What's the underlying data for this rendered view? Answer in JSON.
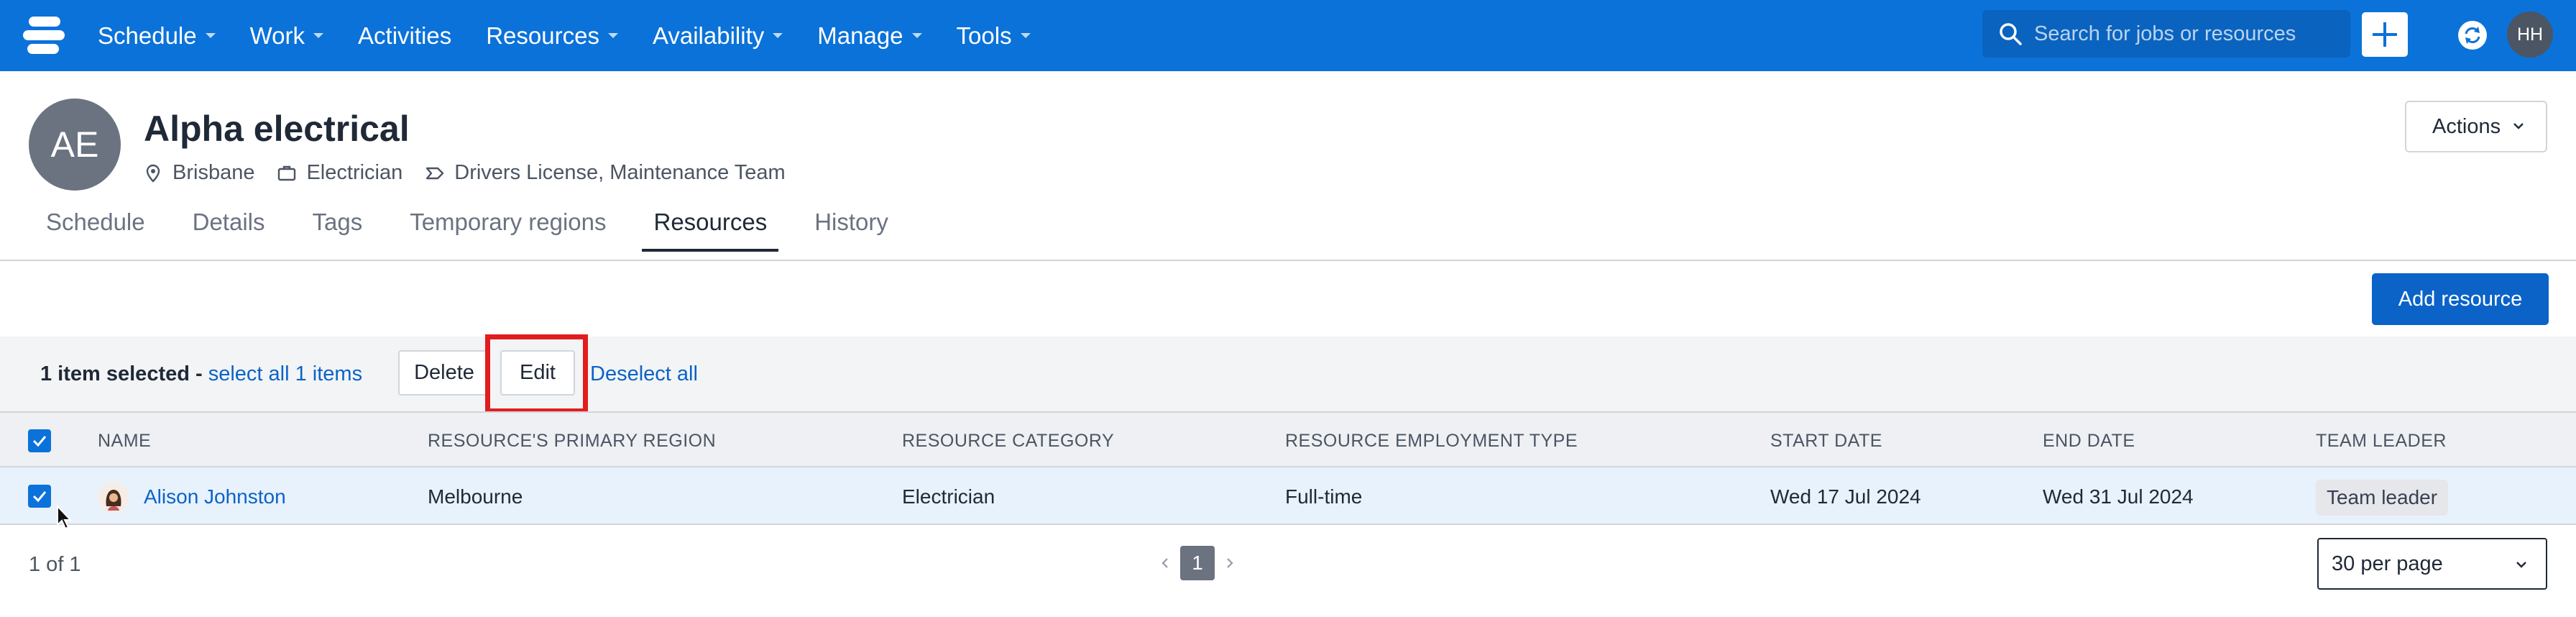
{
  "nav": {
    "items": [
      {
        "label": "Schedule",
        "has_dropdown": true
      },
      {
        "label": "Work",
        "has_dropdown": true
      },
      {
        "label": "Activities",
        "has_dropdown": false
      },
      {
        "label": "Resources",
        "has_dropdown": true
      },
      {
        "label": "Availability",
        "has_dropdown": true
      },
      {
        "label": "Manage",
        "has_dropdown": true
      },
      {
        "label": "Tools",
        "has_dropdown": true
      }
    ],
    "search_placeholder": "Search for jobs or resources",
    "user_initials": "HH",
    "bar_color": "#0b72d9"
  },
  "profile": {
    "initials": "AE",
    "title": "Alpha electrical",
    "location": "Brisbane",
    "category": "Electrician",
    "tags": "Drivers License, Maintenance Team",
    "actions_label": "Actions"
  },
  "tabs": [
    {
      "label": "Schedule",
      "active": false
    },
    {
      "label": "Details",
      "active": false
    },
    {
      "label": "Tags",
      "active": false
    },
    {
      "label": "Temporary regions",
      "active": false
    },
    {
      "label": "Resources",
      "active": true
    },
    {
      "label": "History",
      "active": false
    }
  ],
  "toolbar": {
    "add_resource_label": "Add resource"
  },
  "selection": {
    "count_text": "1 item selected",
    "separator": " - ",
    "select_all_link": "select all 1 items",
    "delete_label": "Delete",
    "edit_label": "Edit",
    "deselect_label": "Deselect all"
  },
  "table": {
    "headers": [
      "NAME",
      "RESOURCE'S PRIMARY REGION",
      "RESOURCE CATEGORY",
      "RESOURCE EMPLOYMENT TYPE",
      "START DATE",
      "END DATE",
      "TEAM LEADER"
    ],
    "rows": [
      {
        "name": "Alison Johnston",
        "region": "Melbourne",
        "category": "Electrician",
        "employment_type": "Full-time",
        "start_date": "Wed 17 Jul 2024",
        "end_date": "Wed 31 Jul 2024",
        "team_leader": "Team leader",
        "selected": true
      }
    ]
  },
  "footer": {
    "count": "1 of 1",
    "current_page": "1",
    "per_page": "30 per page"
  }
}
